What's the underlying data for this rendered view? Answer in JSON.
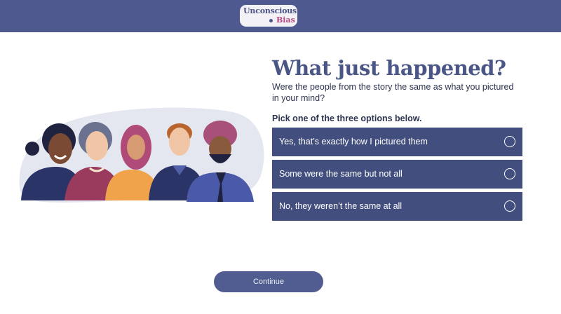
{
  "header": {
    "logo": {
      "line1": "Unconscious",
      "line2": "Bias"
    }
  },
  "content": {
    "title": "What just happened?",
    "subtitle": "Were the people from the story the same as what you pictured in your mind?",
    "prompt": "Pick one of the three options below.",
    "options": [
      {
        "label": "Yes, that’s exactly how I pictured them",
        "selected": false
      },
      {
        "label": "Some were the same but not all",
        "selected": false
      },
      {
        "label": "No, they weren’t the same at all",
        "selected": false
      }
    ]
  },
  "footer": {
    "continue_label": "Continue"
  },
  "colors": {
    "header_bg": "#4e5a8f",
    "option_bg": "#424f7e",
    "title": "#4a5686",
    "button_bg": "#515d91"
  }
}
